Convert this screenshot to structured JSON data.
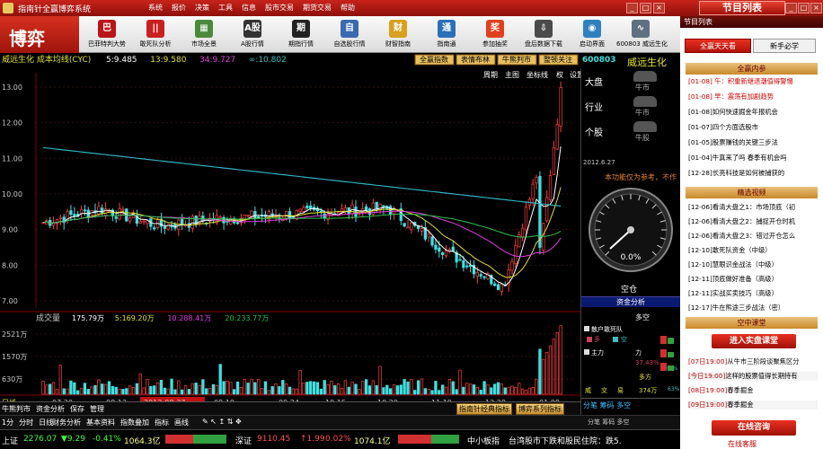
{
  "window": {
    "title": "指南针全赢博弈系统",
    "menu": [
      "系统",
      "报价",
      "决策",
      "工具",
      "信息",
      "股市交易",
      "期货交易",
      "帮助"
    ],
    "right_title": "节目列表",
    "minimize": "_",
    "maximize": "□",
    "close": "×"
  },
  "brand": "博弈",
  "toolbar": [
    {
      "label": "巴菲特判大势",
      "icon": "巴",
      "color": "#b8161a"
    },
    {
      "label": "敢死队分析",
      "icon": "||",
      "color": "#c82020"
    },
    {
      "label": "市场全景",
      "icon": "▦",
      "color": "#4a8a3a"
    },
    {
      "label": "A股行情",
      "icon": "A股",
      "color": "#333"
    },
    {
      "label": "期指行情",
      "icon": "期",
      "color": "#222"
    },
    {
      "label": "自选股行情",
      "icon": "自",
      "color": "#3a6ab0"
    },
    {
      "label": "财智指南",
      "icon": "财",
      "color": "#d8a020"
    },
    {
      "label": "指南通",
      "icon": "通",
      "color": "#2a70b8"
    },
    {
      "label": "参加抽奖",
      "icon": "奖",
      "color": "#e04020"
    },
    {
      "label": "盘后数据下载",
      "icon": "⇩",
      "color": "#4a4a4a"
    },
    {
      "label": "启动界面",
      "icon": "◉",
      "color": "#3080c0"
    },
    {
      "label": "600803 威远生化",
      "icon": "∿",
      "color": "#607080"
    }
  ],
  "chart": {
    "header_left": "威远生化 成本均线(CYC)",
    "ma_labels": [
      {
        "text": "5:9.485",
        "color": "#ffffff"
      },
      {
        "text": "13:9.580",
        "color": "#e0e030"
      },
      {
        "text": "34:9.727",
        "color": "#e040e0"
      },
      {
        "text": "∞:10.802",
        "color": "#40c0c0"
      }
    ],
    "top_buttons": [
      "全赢指数",
      "表情布林",
      "牛熊判市",
      "整顿关注"
    ],
    "right_links": [
      "周期",
      "主图",
      "坐标线",
      "权",
      "设置"
    ],
    "y_ticks": [
      "13.00",
      "12.00",
      "11.00",
      "10.00",
      "9.00",
      "8.00",
      "7.00"
    ],
    "volume_label": "成交量",
    "volume_values": [
      {
        "text": "175.79万",
        "color": "#ffffff"
      },
      {
        "text": "5:169.20万",
        "color": "#e0e030"
      },
      {
        "text": "10:288.41万",
        "color": "#e040e0"
      },
      {
        "text": "20:233.77万",
        "color": "#30c050"
      }
    ],
    "vol_ticks": [
      "2521万",
      "1570万",
      "630万"
    ],
    "x_ticks": [
      "07.30",
      "08.13",
      "2012-08-27",
      "09.10",
      "09.24",
      "10.15",
      "10.29",
      "11.19",
      "12.20",
      "01.08"
    ],
    "period_label": "日线",
    "hover_date": "2012.8.27"
  },
  "chart_data": {
    "type": "candlestick",
    "x": [
      "07.30",
      "08.13",
      "2012-08-27",
      "09.10",
      "09.24",
      "10.15",
      "10.29",
      "11.19",
      "12.20",
      "01.08"
    ],
    "close": [
      9.2,
      9.6,
      9.1,
      9.3,
      9.4,
      9.5,
      9.6,
      8.4,
      7.4,
      12.8
    ],
    "ylim": [
      6.8,
      13.4
    ],
    "volume_ylim": [
      0,
      3000
    ]
  },
  "side": {
    "code": "600803",
    "name": "威远生化",
    "rows": [
      {
        "k": "大盘",
        "v": "牛市"
      },
      {
        "k": "行业",
        "v": "牛市"
      },
      {
        "k": "个股",
        "v": "牛股"
      }
    ],
    "date": "2012.6.27",
    "notice": "本功能仅为参考，不作",
    "gauge_value": "0.0%",
    "gauge_state": "空仓",
    "capital_btn": "资金分析",
    "flow_title": "多空",
    "flow_labels": [
      "散户敢死队",
      "多",
      "空",
      "主力",
      "多",
      "力",
      "37.43%",
      "多方",
      "威",
      "交",
      "易"
    ],
    "flow_val": "374万",
    "flow_pct": "0.0%",
    "flow_pct2": "63%"
  },
  "tabs_bottom": [
    "牛熊判市",
    "资金分析",
    "保存",
    "管理"
  ],
  "tabs_bottom2": [
    "指南针经典指标",
    "博弈系列指标"
  ],
  "subbar": [
    "财务分析",
    "基本资料",
    "指数叠加",
    "指标",
    "画线"
  ],
  "subbar_left": [
    "1分",
    "分时",
    "日线"
  ],
  "right_panel": {
    "tabs": [
      "全赢天天看",
      "新手必学"
    ],
    "sec1": "全赢内参",
    "news": [
      {
        "d": "[01-08] 午：",
        "t": "积重新继退潮值得警惕",
        "red": true
      },
      {
        "d": "[01-08] 早：",
        "t": "震荡有加剧趋势",
        "red": true
      },
      {
        "d": "[01-08]",
        "t": "如何快速掘金年报机会",
        "red": false
      },
      {
        "d": "[01-07]",
        "t": "四个方面选股市",
        "red": false
      },
      {
        "d": "[01-05]",
        "t": "股票赚钱的关键三步法",
        "red": false
      },
      {
        "d": "[01-04]",
        "t": "牛真来了吗 春季有机会吗",
        "red": false
      },
      {
        "d": "[12-28]",
        "t": "长亮科技是如何被捕获的",
        "red": false
      }
    ],
    "sec2": "精选视频",
    "videos": [
      {
        "d": "[12-06]",
        "t": "看清大盘之1：市场顶底（初"
      },
      {
        "d": "[12-06]",
        "t": "看清大盘之2：捕捉开仓时机"
      },
      {
        "d": "[12-06]",
        "t": "看清大盘之3：错过开仓怎么"
      },
      {
        "d": "[12-10]",
        "t": "敢死队资金（中级）"
      },
      {
        "d": "[12-10]",
        "t": "慧眼识金战法（中级）"
      },
      {
        "d": "[12-11]",
        "t": "顶底做好准备（高级）"
      },
      {
        "d": "[12-11]",
        "t": "实战买卖技巧（高级）"
      },
      {
        "d": "[12-17]",
        "t": "牛在熊途三步战法（密）"
      }
    ],
    "sec3": "空中课堂",
    "enter_btn": "进入实盘课堂",
    "classes": [
      {
        "d": "[07日19:00]",
        "t": "从牛市三阶段谈聚焦区分"
      },
      {
        "d": "[今日19:00]",
        "t": "这样的股票值得长期持有"
      },
      {
        "d": "[08日19:00]",
        "t": "春季掘金"
      },
      {
        "d": "[09日19:00]",
        "t": "春季掘金"
      }
    ],
    "consult_btn": "在线咨询",
    "footer": "在线客服"
  },
  "status": {
    "sh_label": "上证",
    "sh_val": "2276.07",
    "sh_chg": "9.29",
    "sh_pct": "-0.41%",
    "sh_amt": "1064.3亿",
    "sz_label": "深证",
    "sz_val": "9110.45",
    "sz_chg": "1.99",
    "sz_pct": "0.02%",
    "sz_amt": "1074.1亿",
    "zx_label": "中小板指",
    "ticker": "台湾股市下跌和股民住院：跌5.",
    "right_text": "分笔 筹码 多空"
  }
}
